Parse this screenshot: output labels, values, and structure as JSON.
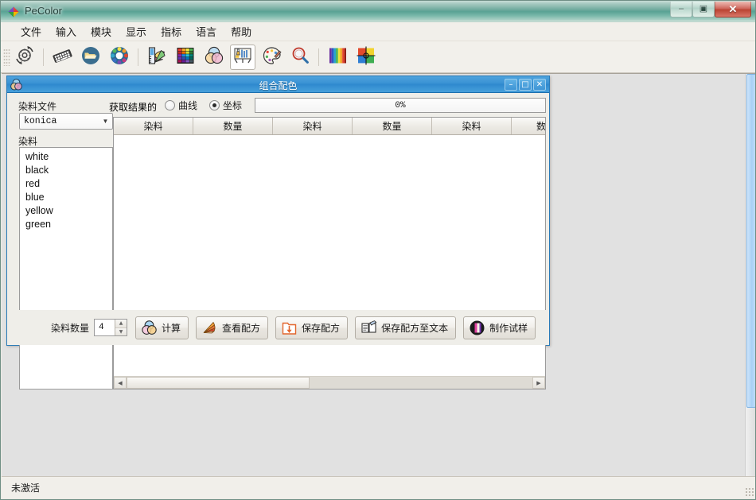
{
  "window": {
    "title": "PeColor",
    "app_icon": "pecolor-diamond-icon",
    "controls": {
      "minimize": "–",
      "maximize": "▣",
      "close": "✕"
    }
  },
  "menubar": {
    "items": [
      {
        "label": "文件",
        "name": "menu-file"
      },
      {
        "label": "输入",
        "name": "menu-input"
      },
      {
        "label": "模块",
        "name": "menu-module"
      },
      {
        "label": "显示",
        "name": "menu-display"
      },
      {
        "label": "指标",
        "name": "menu-index"
      },
      {
        "label": "语言",
        "name": "menu-language"
      },
      {
        "label": "帮助",
        "name": "menu-help"
      }
    ]
  },
  "toolbar": {
    "buttons": [
      {
        "name": "settings-gear-icon",
        "active": false
      },
      {
        "name": "keyboard-icon",
        "active": false
      },
      {
        "name": "folder-icon",
        "active": false
      },
      {
        "name": "color-wheel-icon",
        "active": false
      },
      {
        "name": "color-fan-ruler-icon",
        "active": false
      },
      {
        "name": "color-palette-grid-icon",
        "active": false
      },
      {
        "name": "venn-color-mix-icon",
        "active": false
      },
      {
        "name": "lab-easel-icon",
        "active": true
      },
      {
        "name": "artist-palette-icon",
        "active": false
      },
      {
        "name": "magnifier-icon",
        "active": false
      },
      {
        "name": "spectrum-bars-icon",
        "active": false
      },
      {
        "name": "color-target-icon",
        "active": false
      }
    ]
  },
  "child_window": {
    "title": "组合配色",
    "icon": "venn-color-mix-icon",
    "controls": {
      "minimize": "–",
      "maximize": "□",
      "close": "✕"
    },
    "labels": {
      "dye_file": "染料文件",
      "dye": "染料",
      "get_result_of": "获取结果的",
      "dye_count": "染料数量"
    },
    "dye_file_combo": {
      "value": "konica",
      "arrow": "▼"
    },
    "dye_list": [
      "white",
      "black",
      "red",
      "blue",
      "yellow",
      "green"
    ],
    "result_mode": {
      "options": [
        {
          "label": "曲线",
          "name": "radio-curve",
          "checked": false
        },
        {
          "label": "坐标",
          "name": "radio-coordinate",
          "checked": true
        }
      ]
    },
    "progress": {
      "text": "0%",
      "percent": 0
    },
    "grid": {
      "columns": [
        "染料",
        "数量",
        "染料",
        "数量",
        "染料",
        "数"
      ],
      "rows": [],
      "hscroll": {
        "left_arrow": "◀",
        "right_arrow": "▶",
        "thumb_percent": 45
      }
    },
    "dye_count_spinner": {
      "value": "4",
      "up": "▲",
      "down": "▼"
    },
    "action_buttons": [
      {
        "label": "计算",
        "name": "calculate-button",
        "icon": "venn-color-mix-icon"
      },
      {
        "label": "查看配方",
        "name": "view-recipe-button",
        "icon": "color-fan-icon"
      },
      {
        "label": "保存配方",
        "name": "save-recipe-button",
        "icon": "save-download-icon"
      },
      {
        "label": "保存配方至文本",
        "name": "save-recipe-to-text-button",
        "icon": "book-edit-icon"
      },
      {
        "label": "制作试样",
        "name": "make-sample-button",
        "icon": "sample-swatch-icon"
      }
    ]
  },
  "statusbar": {
    "text": "未激活"
  },
  "colors": {
    "titlebar_teal": "#59a294",
    "child_titlebar_blue": "#2f89ce",
    "close_button_red": "#b8402f",
    "mdi_background": "#e1e1e1",
    "panel_background": "#efeee9",
    "scrollbar_thumb_blue": "#a9d0f5"
  }
}
